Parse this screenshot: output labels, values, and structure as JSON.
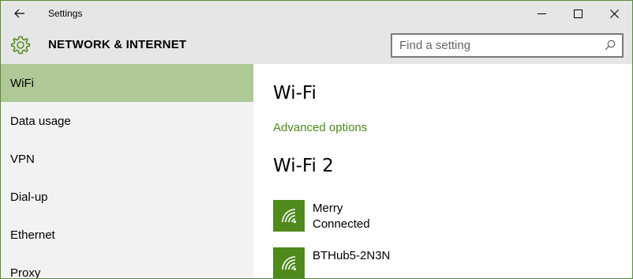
{
  "window": {
    "title": "Settings",
    "controls": [
      "minimize-icon",
      "maximize-icon",
      "close-icon"
    ]
  },
  "header": {
    "title": "NETWORK & INTERNET",
    "icon": "gear-icon"
  },
  "search": {
    "placeholder": "Find a setting",
    "value": ""
  },
  "sidebar": {
    "items": [
      {
        "label": "WiFi",
        "selected": true
      },
      {
        "label": "Data usage",
        "selected": false
      },
      {
        "label": "VPN",
        "selected": false
      },
      {
        "label": "Dial-up",
        "selected": false
      },
      {
        "label": "Ethernet",
        "selected": false
      },
      {
        "label": "Proxy",
        "selected": false
      }
    ]
  },
  "main": {
    "section1_title": "Wi-Fi",
    "advanced_link": "Advanced options",
    "section2_title": "Wi-Fi 2",
    "networks": [
      {
        "name": "Merry",
        "status": "Connected",
        "icon": "wifi-icon"
      },
      {
        "name": "BTHub5-2N3N",
        "status": "",
        "icon": "wifi-icon"
      }
    ]
  },
  "colors": {
    "accent": "#4f8a1d",
    "link": "#4a8a1f",
    "selected_nav": "#aec896",
    "chrome": "#e6e6e6",
    "sidebar": "#f2f2f2"
  }
}
